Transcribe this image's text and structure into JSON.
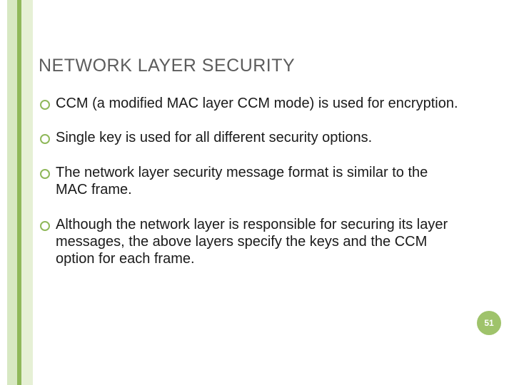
{
  "title": "NETWORK LAYER SECURITY",
  "bullets": [
    "CCM (a modified MAC layer CCM mode) is used for encryption.",
    "Single key is used for all different security options.",
    "The network layer security message format is similar to the MAC frame.",
    "Although the network layer is responsible for securing its layer messages, the above layers specify the keys and the CCM option for each frame."
  ],
  "page_number": "51"
}
